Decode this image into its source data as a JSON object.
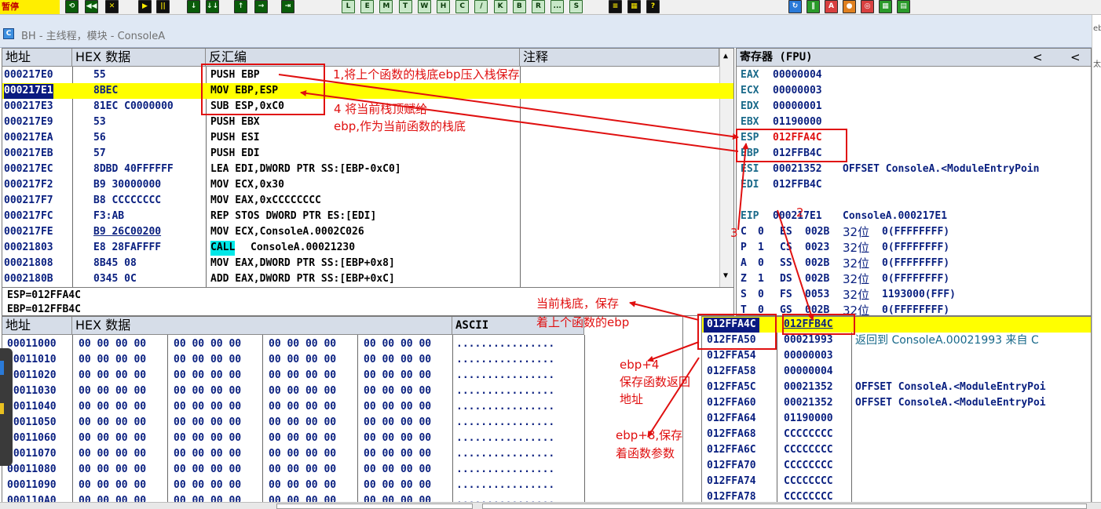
{
  "toolbar": {
    "paused_label": "暂停",
    "run_buttons": [
      "⟲",
      "◀◀",
      "✕",
      "▶",
      "||",
      "↓",
      "↓↓",
      "↑",
      "→",
      "⇥"
    ],
    "window_buttons": [
      "L",
      "E",
      "M",
      "T",
      "W",
      "H",
      "C",
      "/",
      "K",
      "B",
      "R",
      "...",
      "S"
    ],
    "extra_buttons": [
      "≡",
      "▦",
      "?"
    ],
    "right_buttons": [
      "↻",
      "∥",
      "A",
      "●",
      "◎",
      "▦",
      "▤"
    ]
  },
  "title": {
    "icon_label": "C",
    "text": "BH - 主线程，模块 - ConsoleA"
  },
  "right_strip_text": [
    "eb",
    "太/"
  ],
  "disasm": {
    "headers": {
      "address": "地址",
      "hex": "HEX 数据",
      "disasm": "反汇编",
      "comment": "注释"
    },
    "rows": [
      {
        "addr": "000217E0",
        "hex": "55",
        "asm": "PUSH EBP"
      },
      {
        "addr": "000217E1",
        "hex": "8BEC",
        "asm": "MOV EBP,ESP"
      },
      {
        "addr": "000217E3",
        "hex": "81EC C0000000",
        "asm": "SUB ESP,0xC0"
      },
      {
        "addr": "000217E9",
        "hex": "53",
        "asm": "PUSH EBX"
      },
      {
        "addr": "000217EA",
        "hex": "56",
        "asm": "PUSH ESI"
      },
      {
        "addr": "000217EB",
        "hex": "57",
        "asm": "PUSH EDI"
      },
      {
        "addr": "000217EC",
        "hex": "8DBD 40FFFFFF",
        "asm": "LEA EDI,DWORD PTR SS:[EBP-0xC0]"
      },
      {
        "addr": "000217F2",
        "hex": "B9 30000000",
        "asm": "MOV ECX,0x30"
      },
      {
        "addr": "000217F7",
        "hex": "B8 CCCCCCCC",
        "asm": "MOV EAX,0xCCCCCCCC"
      },
      {
        "addr": "000217FC",
        "hex": "F3:AB",
        "asm": "REP STOS DWORD PTR ES:[EDI]"
      },
      {
        "addr": "000217FE",
        "hex": "B9 26C00200",
        "asm": "MOV ECX,ConsoleA.0002C026"
      },
      {
        "addr": "00021803",
        "hex": "E8 28FAFFFF",
        "asm": "ConsoleA.00021230",
        "asm_prefix": "CALL"
      },
      {
        "addr": "00021808",
        "hex": "8B45 08",
        "asm": "MOV EAX,DWORD PTR SS:[EBP+0x8]"
      },
      {
        "addr": "0002180B",
        "hex": "0345 0C",
        "asm": "ADD EAX,DWORD PTR SS:[EBP+0xC]"
      }
    ],
    "selected_row": 1
  },
  "info": {
    "line1": "ESP=012FFA4C",
    "line2": "EBP=012FFB4C"
  },
  "registers": {
    "header": "寄存器 (FPU)",
    "nav_left": "<",
    "nav_left2": "<",
    "lines": [
      {
        "name": "EAX",
        "value": "00000004",
        "extra": ""
      },
      {
        "name": "ECX",
        "value": "00000003",
        "extra": ""
      },
      {
        "name": "EDX",
        "value": "00000001",
        "extra": ""
      },
      {
        "name": "EBX",
        "value": "01190000",
        "extra": ""
      },
      {
        "name": "ESP",
        "value": "012FFA4C",
        "extra": ""
      },
      {
        "name": "EBP",
        "value": "012FFB4C",
        "extra": ""
      },
      {
        "name": "ESI",
        "value": "00021352",
        "extra": "OFFSET ConsoleA.<ModuleEntryPoin"
      },
      {
        "name": "EDI",
        "value": "012FFB4C",
        "extra": ""
      },
      {
        "name": "",
        "value": "",
        "extra": ""
      },
      {
        "name": "EIP",
        "value": "000217E1",
        "extra": "ConsoleA.000217E1"
      }
    ],
    "flags": [
      {
        "f": "C",
        "v": "0",
        "seg": "ES",
        "sel": "002B",
        "bits": "32位",
        "desc": "0(FFFFFFFF)"
      },
      {
        "f": "P",
        "v": "1",
        "seg": "CS",
        "sel": "0023",
        "bits": "32位",
        "desc": "0(FFFFFFFF)"
      },
      {
        "f": "A",
        "v": "0",
        "seg": "SS",
        "sel": "002B",
        "bits": "32位",
        "desc": "0(FFFFFFFF)"
      },
      {
        "f": "Z",
        "v": "1",
        "seg": "DS",
        "sel": "002B",
        "bits": "32位",
        "desc": "0(FFFFFFFF)"
      },
      {
        "f": "S",
        "v": "0",
        "seg": "FS",
        "sel": "0053",
        "bits": "32位",
        "desc": "1193000(FFF)"
      },
      {
        "f": "T",
        "v": "0",
        "seg": "GS",
        "sel": "002B",
        "bits": "32位",
        "desc": "0(FFFFFFFF)"
      }
    ]
  },
  "dump": {
    "headers": {
      "address": "地址",
      "hex": "HEX 数据",
      "ascii": "ASCII"
    },
    "rows": [
      {
        "addr": "00011000",
        "bytes": "00 00 00 00",
        "ascii": "................"
      },
      {
        "addr": "00011010",
        "bytes": "00 00 00 00",
        "ascii": "................"
      },
      {
        "addr": "00011020",
        "bytes": "00 00 00 00",
        "ascii": "................"
      },
      {
        "addr": "00011030",
        "bytes": "00 00 00 00",
        "ascii": "................"
      },
      {
        "addr": "00011040",
        "bytes": "00 00 00 00",
        "ascii": "................"
      },
      {
        "addr": "00011050",
        "bytes": "00 00 00 00",
        "ascii": "................"
      },
      {
        "addr": "00011060",
        "bytes": "00 00 00 00",
        "ascii": "................"
      },
      {
        "addr": "00011070",
        "bytes": "00 00 00 00",
        "ascii": "................"
      },
      {
        "addr": "00011080",
        "bytes": "00 00 00 00",
        "ascii": "................"
      },
      {
        "addr": "00011090",
        "bytes": "00 00 00 00",
        "ascii": "................"
      },
      {
        "addr": "000110A0",
        "bytes": "00 00 00 00",
        "ascii": "................"
      }
    ]
  },
  "stack": {
    "rows": [
      {
        "addr": "012FFA4C",
        "value": "012FFB4C",
        "comment": ""
      },
      {
        "addr": "012FFA50",
        "value": "00021993",
        "comment": "返回到 ConsoleA.00021993 来自 C"
      },
      {
        "addr": "012FFA54",
        "value": "00000003",
        "comment": ""
      },
      {
        "addr": "012FFA58",
        "value": "00000004",
        "comment": ""
      },
      {
        "addr": "012FFA5C",
        "value": "00021352",
        "comment": "OFFSET ConsoleA.<ModuleEntryPoi"
      },
      {
        "addr": "012FFA60",
        "value": "00021352",
        "comment": "OFFSET ConsoleA.<ModuleEntryPoi"
      },
      {
        "addr": "012FFA64",
        "value": "01190000",
        "comment": ""
      },
      {
        "addr": "012FFA68",
        "value": "CCCCCCCC",
        "comment": ""
      },
      {
        "addr": "012FFA6C",
        "value": "CCCCCCCC",
        "comment": ""
      },
      {
        "addr": "012FFA70",
        "value": "CCCCCCCC",
        "comment": ""
      },
      {
        "addr": "012FFA74",
        "value": "CCCCCCCC",
        "comment": ""
      },
      {
        "addr": "012FFA78",
        "value": "CCCCCCCC",
        "comment": ""
      }
    ],
    "selected_row": 0
  },
  "annotations": {
    "n1": "1,将上个函数的栈底ebp压入栈保存",
    "n4a": "4 将当前栈顶赋给",
    "n4b": "ebp,作为当前函数的栈底",
    "n2": "2",
    "n3": "3",
    "cur_a": "当前栈底，保存",
    "cur_b": "着上个函数的ebp",
    "e4a": "ebp+4",
    "e4b": "保存函数返回",
    "e4c": "地址",
    "e8a": "ebp+8,保存",
    "e8b": "着函数参数",
    "color": "#e01010"
  },
  "colors": {
    "selection": "#ffff00",
    "address_fg": "#0a2080",
    "selected_addr_bg": "#0a1a80",
    "annotation": "#e01010"
  }
}
